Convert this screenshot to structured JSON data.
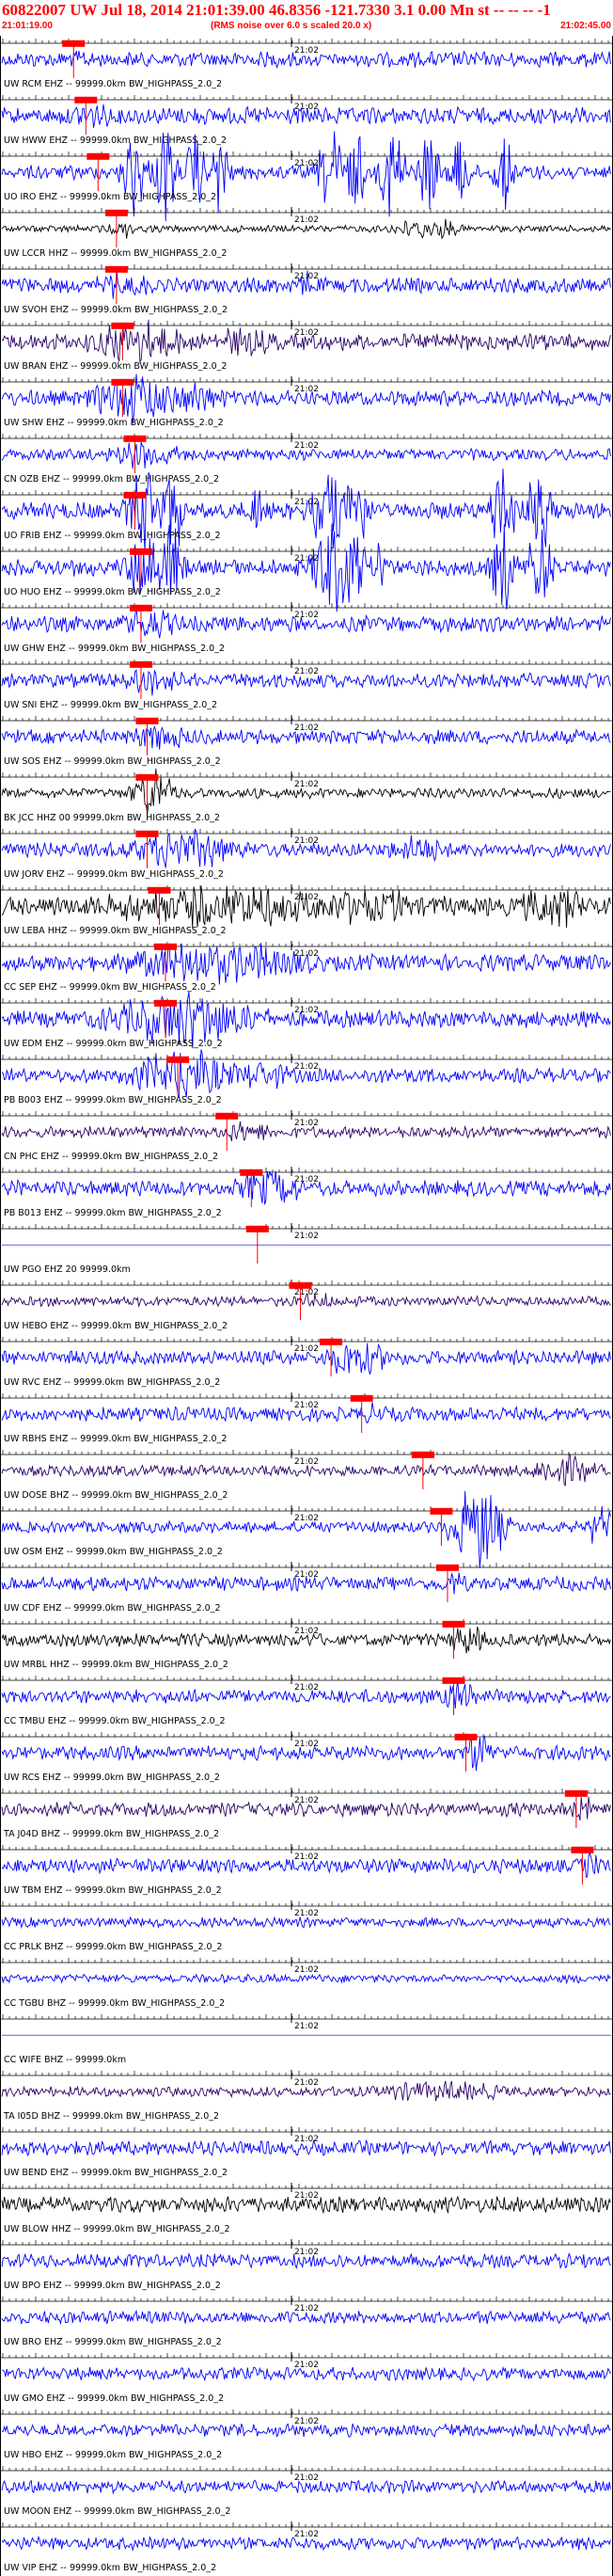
{
  "header": {
    "title": "60822007 UW Jul 18, 2014 21:01:39.00   46.8356 -121.7330  3.1 0.00 Mn st -- -- -- -1",
    "start_time": "21:01:19.00",
    "noise_note": "(RMS noise over 6.0 s scaled 20.0 x)",
    "end_time": "21:02:45.00"
  },
  "chart_data": {
    "type": "line",
    "title": "60822007 UW Jul 18, 2014 21:01:39.00   46.8356 -121.7330  3.1 0.00 Mn st -- -- -- -1",
    "x_range": [
      "21:01:19.00",
      "21:02:45.00"
    ],
    "minute_label": "21:02",
    "colors": {
      "pick": "#ff0000",
      "blue": "#0000ff",
      "black": "#000000",
      "purple": "#2a0066"
    },
    "series": [
      {
        "name": "UW RCM EHZ -- 99999.0km BW_HIGHPASS_2.0_2",
        "color": "blue",
        "amp": 0.55,
        "pick": 0.12,
        "bursts": [
          [
            0.12,
            0.05,
            0.5
          ]
        ]
      },
      {
        "name": "UW HWW EHZ -- 99999.0km BW_HIGHPASS_2.0_2",
        "color": "blue",
        "amp": 0.6,
        "pick": 0.14,
        "bursts": [
          [
            0.14,
            0.06,
            0.6
          ]
        ]
      },
      {
        "name": "UO IRO EHZ -- 99999.0km BW_HIGHPASS_2.0_2",
        "color": "blue",
        "amp": 0.5,
        "pick": 0.16,
        "bursts": [
          [
            0.22,
            0.02,
            3.2
          ],
          [
            0.27,
            0.02,
            3.2
          ],
          [
            0.32,
            0.015,
            3.0
          ],
          [
            0.36,
            0.015,
            3.0
          ],
          [
            0.54,
            0.02,
            3.2
          ],
          [
            0.58,
            0.015,
            3.0
          ],
          [
            0.64,
            0.02,
            3.2
          ],
          [
            0.7,
            0.015,
            3.0
          ],
          [
            0.75,
            0.015,
            3.2
          ],
          [
            0.82,
            0.015,
            3.2
          ]
        ]
      },
      {
        "name": "UW LCCR HHZ -- 99999.0km BW_HIGHPASS_2.0_2",
        "color": "black",
        "amp": 0.25,
        "pick": 0.19,
        "bursts": [
          [
            0.2,
            0.02,
            0.6
          ],
          [
            0.7,
            0.05,
            0.8
          ]
        ]
      },
      {
        "name": "UW SVOH EHZ -- 99999.0km BW_HIGHPASS_2.0_2",
        "color": "blue",
        "amp": 0.55,
        "pick": 0.19,
        "bursts": [
          [
            0.2,
            0.05,
            0.8
          ],
          [
            0.5,
            0.01,
            0.9
          ]
        ]
      },
      {
        "name": "UW BRAN EHZ -- 99999.0km BW_HIGHPASS_2.0_2",
        "color": "purple",
        "amp": 0.6,
        "pick": 0.2,
        "bursts": [
          [
            0.22,
            0.08,
            1.4
          ],
          [
            0.4,
            0.06,
            0.8
          ]
        ]
      },
      {
        "name": "UW SHW EHZ -- 99999.0km BW_HIGHPASS_2.0_2",
        "color": "blue",
        "amp": 0.55,
        "pick": 0.2,
        "bursts": [
          [
            0.22,
            0.07,
            1.6
          ],
          [
            0.32,
            0.05,
            0.9
          ]
        ]
      },
      {
        "name": "CN OZB EHZ -- 99999.0km BW_HIGHPASS_2.0_2",
        "color": "blue",
        "amp": 0.4,
        "pick": 0.22,
        "bursts": [
          [
            0.24,
            0.06,
            0.9
          ]
        ]
      },
      {
        "name": "UO FRIB EHZ -- 99999.0km BW_HIGHPASS_2.0_2",
        "color": "blue",
        "amp": 0.6,
        "pick": 0.22,
        "bursts": [
          [
            0.24,
            0.03,
            3.0
          ],
          [
            0.28,
            0.02,
            3.0
          ],
          [
            0.54,
            0.03,
            3.2
          ],
          [
            0.58,
            0.02,
            3.0
          ],
          [
            0.82,
            0.02,
            3.2
          ],
          [
            0.88,
            0.02,
            3.2
          ],
          [
            0.42,
            0.01,
            2.0
          ]
        ]
      },
      {
        "name": "UO HUO EHZ -- 99999.0km BW_HIGHPASS_2.0_2",
        "color": "blue",
        "amp": 0.6,
        "pick": 0.23,
        "bursts": [
          [
            0.24,
            0.03,
            3.0
          ],
          [
            0.28,
            0.02,
            3.0
          ],
          [
            0.54,
            0.03,
            3.2
          ],
          [
            0.58,
            0.02,
            3.0
          ],
          [
            0.82,
            0.02,
            3.0
          ],
          [
            0.88,
            0.02,
            3.2
          ],
          [
            0.62,
            0.01,
            2.0
          ]
        ]
      },
      {
        "name": "UW GHW EHZ -- 99999.0km BW_HIGHPASS_2.0_2",
        "color": "blue",
        "amp": 0.55,
        "pick": 0.23,
        "bursts": [
          [
            0.24,
            0.05,
            1.0
          ]
        ]
      },
      {
        "name": "UW SNI EHZ -- 99999.0km BW_HIGHPASS_2.0_2",
        "color": "blue",
        "amp": 0.5,
        "pick": 0.23,
        "bursts": [
          [
            0.25,
            0.05,
            0.8
          ]
        ]
      },
      {
        "name": "UW SOS EHZ -- 99999.0km BW_HIGHPASS_2.0_2",
        "color": "blue",
        "amp": 0.5,
        "pick": 0.24,
        "bursts": [
          [
            0.26,
            0.05,
            0.8
          ]
        ]
      },
      {
        "name": "BK JCC HHZ 00 99999.0km BW_HIGHPASS_2.0_2",
        "color": "black",
        "amp": 0.35,
        "pick": 0.24,
        "bursts": [
          [
            0.25,
            0.03,
            1.8
          ]
        ]
      },
      {
        "name": "UW JORV EHZ -- 99999.0km BW_HIGHPASS_2.0_2",
        "color": "blue",
        "amp": 0.5,
        "pick": 0.24,
        "bursts": [
          [
            0.3,
            0.1,
            1.2
          ],
          [
            0.68,
            0.05,
            0.8
          ]
        ]
      },
      {
        "name": "UW LEBA HHZ -- 99999.0km BW_HIGHPASS_2.0_2",
        "color": "black",
        "amp": 0.7,
        "pick": 0.26,
        "bursts": [
          [
            0.35,
            0.18,
            1.3
          ],
          [
            0.6,
            0.12,
            1.0
          ],
          [
            0.9,
            0.05,
            1.4
          ]
        ]
      },
      {
        "name": "CC SEP EHZ -- 99999.0km BW_HIGHPASS_2.0_2",
        "color": "blue",
        "amp": 0.6,
        "pick": 0.27,
        "bursts": [
          [
            0.35,
            0.15,
            1.4
          ]
        ]
      },
      {
        "name": "UW EDM EHZ -- 99999.0km BW_HIGHPASS_2.0_2",
        "color": "blue",
        "amp": 0.6,
        "pick": 0.27,
        "bursts": [
          [
            0.3,
            0.12,
            1.8
          ]
        ]
      },
      {
        "name": "PB B003 EHZ -- 99999.0km BW_HIGHPASS_2.0_2",
        "color": "blue",
        "amp": 0.5,
        "pick": 0.29,
        "bursts": [
          [
            0.3,
            0.08,
            1.8
          ],
          [
            0.42,
            0.05,
            1.0
          ]
        ]
      },
      {
        "name": "CN PHC EHZ -- 99999.0km BW_HIGHPASS_2.0_2",
        "color": "purple",
        "amp": 0.4,
        "pick": 0.37,
        "bursts": [
          [
            0.4,
            0.05,
            0.6
          ]
        ]
      },
      {
        "name": "PB B013 EHZ -- 99999.0km BW_HIGHPASS_2.0_2",
        "color": "blue",
        "amp": 0.55,
        "pick": 0.41,
        "bursts": [
          [
            0.44,
            0.05,
            1.4
          ]
        ]
      },
      {
        "name": "UW PGO EHZ 20 99999.0km",
        "color": "blue",
        "amp": 0.0,
        "pick": 0.42,
        "bursts": []
      },
      {
        "name": "UW HEBO EHZ -- 99999.0km BW_HIGHPASS_2.0_2",
        "color": "purple",
        "amp": 0.35,
        "pick": 0.49,
        "bursts": [
          [
            0.52,
            0.03,
            0.5
          ]
        ]
      },
      {
        "name": "UW RVC EHZ -- 99999.0km BW_HIGHPASS_2.0_2",
        "color": "blue",
        "amp": 0.5,
        "pick": 0.54,
        "bursts": [
          [
            0.58,
            0.05,
            1.2
          ]
        ]
      },
      {
        "name": "UW RBHS EHZ -- 99999.0km BW_HIGHPASS_2.0_2",
        "color": "blue",
        "amp": 0.5,
        "pick": 0.59,
        "bursts": [
          [
            0.6,
            0.03,
            0.6
          ]
        ]
      },
      {
        "name": "UW DOSE BHZ -- 99999.0km BW_HIGHPASS_2.0_2",
        "color": "purple",
        "amp": 0.4,
        "pick": 0.69,
        "bursts": [
          [
            0.92,
            0.05,
            1.0
          ]
        ]
      },
      {
        "name": "UW OSM EHZ -- 99999.0km BW_HIGHPASS_2.0_2",
        "color": "blue",
        "amp": 0.4,
        "pick": 0.72,
        "bursts": [
          [
            0.78,
            0.04,
            3.2
          ],
          [
            0.98,
            0.02,
            1.5
          ]
        ]
      },
      {
        "name": "UW CDF EHZ -- 99999.0km BW_HIGHPASS_2.0_2",
        "color": "blue",
        "amp": 0.5,
        "pick": 0.73,
        "bursts": [
          [
            0.74,
            0.02,
            0.8
          ]
        ]
      },
      {
        "name": "UW MRBL HHZ -- 99999.0km BW_HIGHPASS_2.0_2",
        "color": "black",
        "amp": 0.45,
        "pick": 0.74,
        "bursts": [
          [
            0.76,
            0.03,
            1.0
          ]
        ]
      },
      {
        "name": "CC TMBU EHZ -- 99999.0km BW_HIGHPASS_2.0_2",
        "color": "blue",
        "amp": 0.5,
        "pick": 0.74,
        "bursts": [
          [
            0.75,
            0.03,
            0.9
          ]
        ]
      },
      {
        "name": "UW RCS EHZ -- 99999.0km BW_HIGHPASS_2.0_2",
        "color": "blue",
        "amp": 0.5,
        "pick": 0.76,
        "bursts": [
          [
            0.78,
            0.02,
            1.6
          ]
        ]
      },
      {
        "name": "TA J04D BHZ -- 99999.0km BW_HIGHPASS_2.0_2",
        "color": "purple",
        "amp": 0.5,
        "pick": 0.94,
        "bursts": [
          [
            0.95,
            0.02,
            0.8
          ]
        ]
      },
      {
        "name": "UW TBM EHZ -- 99999.0km BW_HIGHPASS_2.0_2",
        "color": "blue",
        "amp": 0.5,
        "pick": 0.95,
        "bursts": [
          [
            0.96,
            0.02,
            0.8
          ]
        ]
      },
      {
        "name": "CC PRLK BHZ -- 99999.0km BW_HIGHPASS_2.0_2",
        "color": "blue",
        "amp": 0.35,
        "pick": null,
        "bursts": []
      },
      {
        "name": "CC TGBU BHZ -- 99999.0km BW_HIGHPASS_2.0_2",
        "color": "blue",
        "amp": 0.3,
        "pick": null,
        "bursts": []
      },
      {
        "name": "CC WIFE BHZ -- 99999.0km",
        "color": "blue",
        "amp": 0.0,
        "pick": null,
        "bursts": []
      },
      {
        "name": "TA I05D BHZ -- 99999.0km BW_HIGHPASS_2.0_2",
        "color": "purple",
        "amp": 0.35,
        "pick": null,
        "bursts": [
          [
            0.72,
            0.12,
            0.6
          ]
        ]
      },
      {
        "name": "UW BEND EHZ -- 99999.0km BW_HIGHPASS_2.0_2",
        "color": "blue",
        "amp": 0.5,
        "pick": null,
        "bursts": []
      },
      {
        "name": "UW BLOW HHZ -- 99999.0km BW_HIGHPASS_2.0_2",
        "color": "black",
        "amp": 0.55,
        "pick": null,
        "bursts": []
      },
      {
        "name": "UW BPO EHZ -- 99999.0km BW_HIGHPASS_2.0_2",
        "color": "blue",
        "amp": 0.5,
        "pick": null,
        "bursts": []
      },
      {
        "name": "UW BRO EHZ -- 99999.0km BW_HIGHPASS_2.0_2",
        "color": "blue",
        "amp": 0.45,
        "pick": null,
        "bursts": []
      },
      {
        "name": "UW GMO EHZ -- 99999.0km BW_HIGHPASS_2.0_2",
        "color": "blue",
        "amp": 0.45,
        "pick": null,
        "bursts": []
      },
      {
        "name": "UW HBO EHZ -- 99999.0km BW_HIGHPASS_2.0_2",
        "color": "blue",
        "amp": 0.45,
        "pick": null,
        "bursts": []
      },
      {
        "name": "UW MOON EHZ -- 99999.0km BW_HIGHPASS_2.0_2",
        "color": "blue",
        "amp": 0.45,
        "pick": null,
        "bursts": []
      },
      {
        "name": "UW VIP EHZ -- 99999.0km BW_HIGHPASS_2.0_2",
        "color": "blue",
        "amp": 0.45,
        "pick": null,
        "bursts": []
      }
    ]
  }
}
